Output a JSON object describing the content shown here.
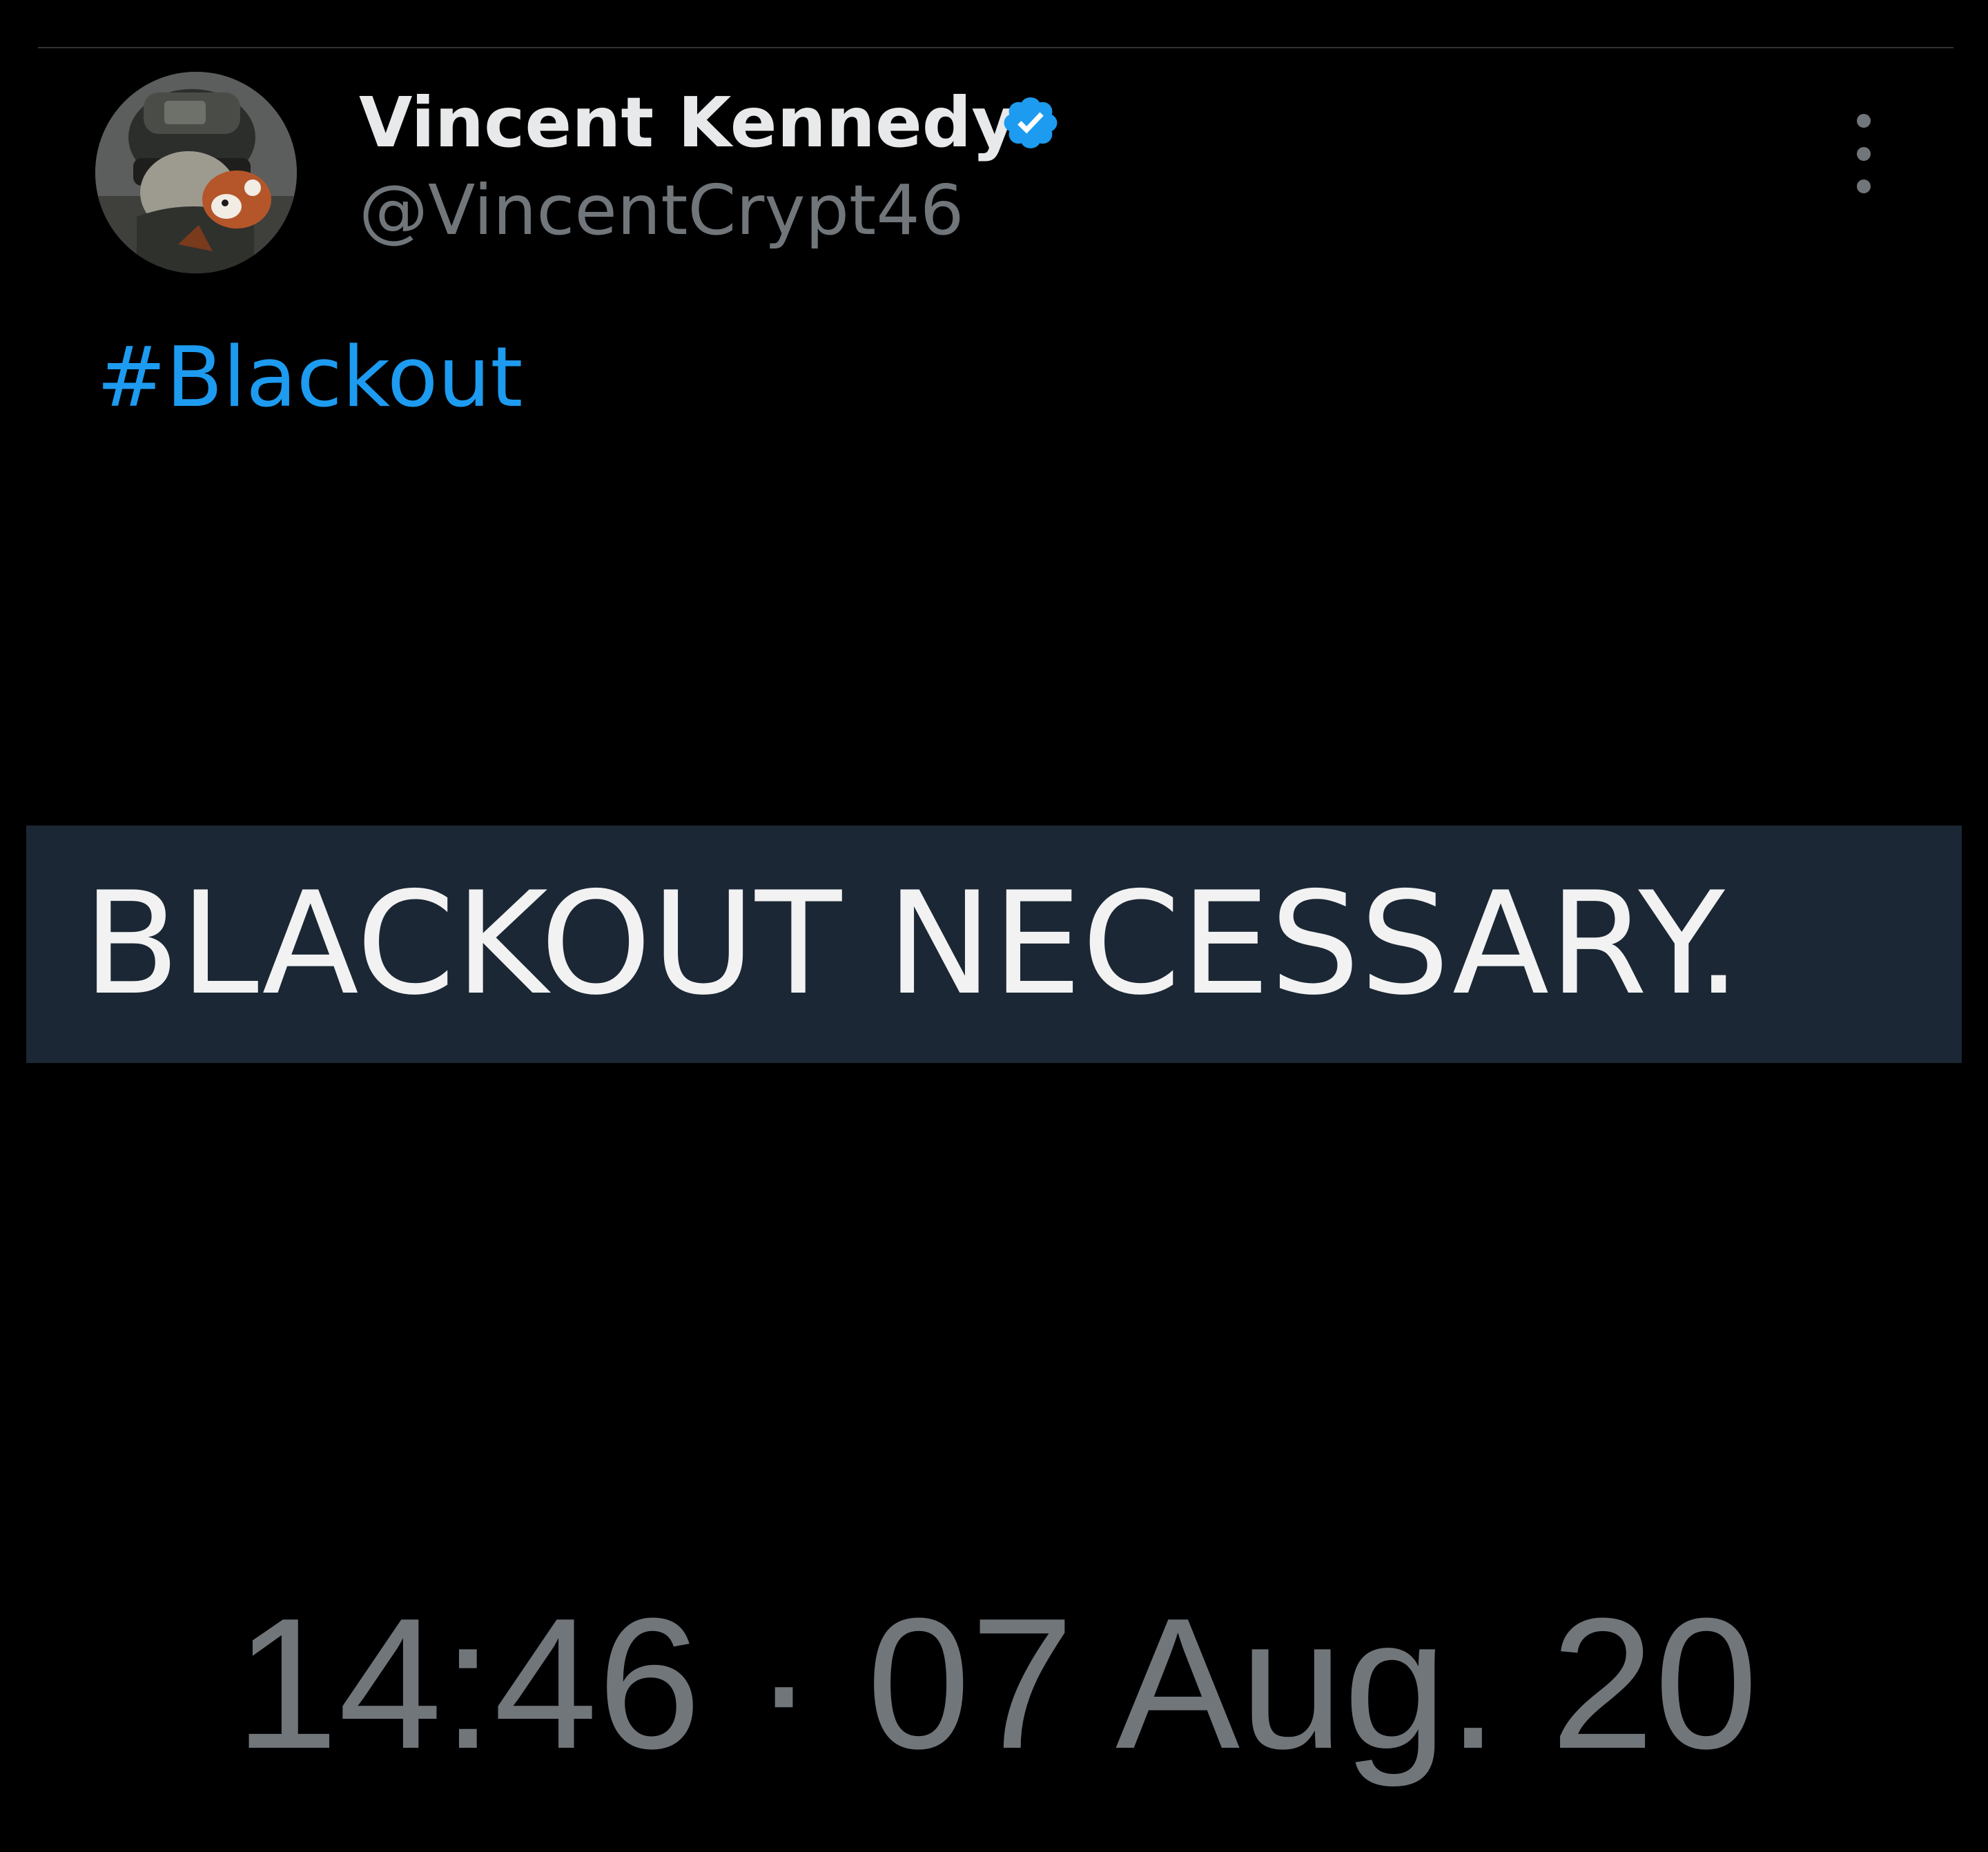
{
  "tweet": {
    "author": {
      "name": "Vincent Kennedy",
      "handle": "@VincentCrypt46",
      "verified": true,
      "avatar_icon": "soldier-with-red-panda-avatar"
    },
    "menu_icon": "more-vertical-icon",
    "text": {
      "hashtag": "#Blackout"
    },
    "media": {
      "banner_text": "BLACKOUT NECESSARY."
    },
    "timestamp": "14:46 · 07 Aug. 20"
  },
  "colors": {
    "background": "#000000",
    "primary_text": "#e7e9ea",
    "secondary_text": "#71767b",
    "link": "#1d9bf0",
    "verified_badge": "#1d9bf0",
    "banner_background": "#1b2734",
    "banner_text": "#f2f2f2",
    "divider": "#2f3336"
  }
}
